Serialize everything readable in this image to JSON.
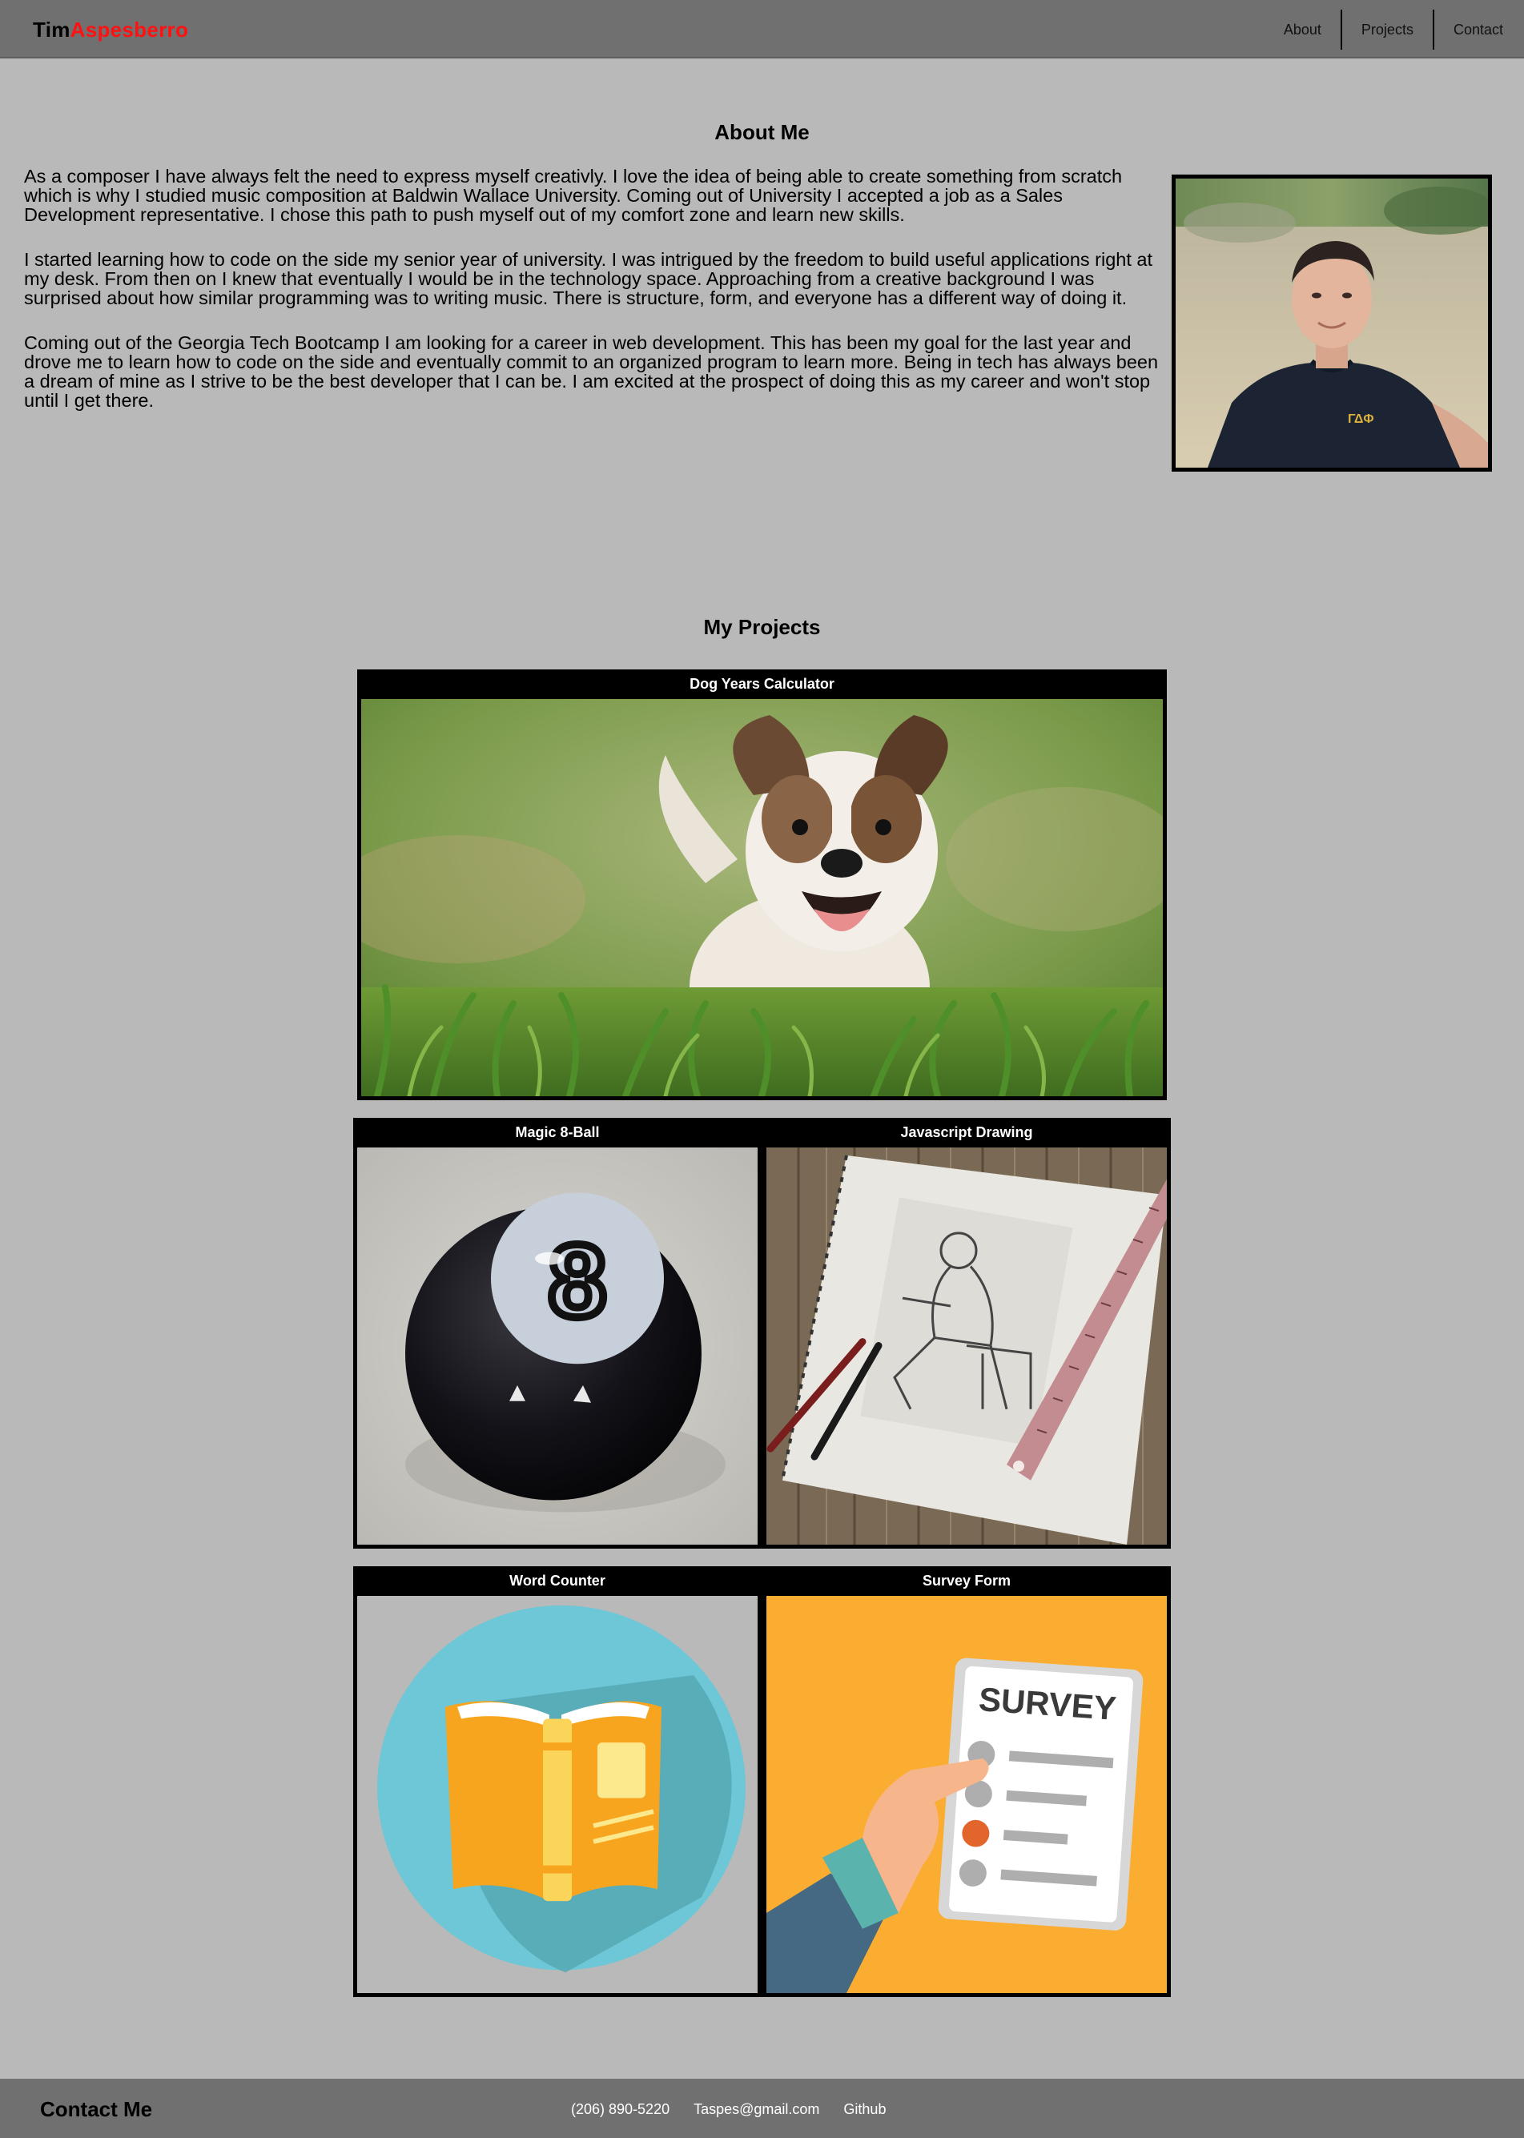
{
  "header": {
    "brand_first": "Tim",
    "brand_last": "Aspesberro",
    "brand_last_color": "#ff1111",
    "nav": [
      {
        "label": "About"
      },
      {
        "label": "Projects"
      },
      {
        "label": "Contact"
      }
    ]
  },
  "about": {
    "title": "About Me",
    "paragraphs": [
      "As a composer I have always felt the need to express myself creativly. I love the idea of being able to create something from scratch which is why I studied music composition at Baldwin Wallace University. Coming out of University I accepted a job as a Sales Development representative. I chose this path to push myself out of my comfort zone and learn new skills.",
      "I started learning how to code on the side my senior year of university. I was intrigued by the freedom to build useful applications right at my desk. From then on I knew that eventually I would be in the technology space. Approaching from a creative background I was surprised about how similar programming was to writing music. There is structure, form, and everyone has a different way of doing it.",
      "Coming out of the Georgia Tech Bootcamp I am looking for a career in web development. This has been my goal for the last year and drove me to learn how to code on the side and eventually commit to an organized program to learn more. Being in tech has always been a dream of mine as I strive to be the best developer that I can be. I am excited at the prospect of doing this as my career and won't stop until I get there."
    ]
  },
  "projects": {
    "title": "My Projects",
    "items": [
      {
        "title": "Dog Years Calculator",
        "image": "puppy-photo"
      },
      {
        "title": "Magic 8-Ball",
        "image": "magic-8-ball-photo"
      },
      {
        "title": "Javascript Drawing",
        "image": "sketchbook-drawing-photo"
      },
      {
        "title": "Word Counter",
        "image": "open-book-illustration"
      },
      {
        "title": "Survey Form",
        "image": "survey-illustration"
      }
    ]
  },
  "footer": {
    "title": "Contact Me",
    "links": [
      {
        "label": "(206) 890-5220"
      },
      {
        "label": "Taspes@gmail.com"
      },
      {
        "label": "Github"
      }
    ]
  }
}
